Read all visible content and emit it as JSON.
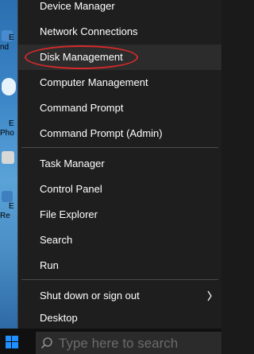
{
  "menu": {
    "items": [
      {
        "label": "Device Manager"
      },
      {
        "label": "Network Connections"
      },
      {
        "label": "Disk Management"
      },
      {
        "label": "Computer Management"
      },
      {
        "label": "Command Prompt"
      },
      {
        "label": "Command Prompt (Admin)"
      },
      {
        "label": "Task Manager"
      },
      {
        "label": "Control Panel"
      },
      {
        "label": "File Explorer"
      },
      {
        "label": "Search"
      },
      {
        "label": "Run"
      },
      {
        "label": "Shut down or sign out"
      },
      {
        "label": "Desktop"
      }
    ]
  },
  "desktop": {
    "labels": [
      "E",
      "nd",
      "E",
      "Pho",
      "E",
      "Re"
    ]
  },
  "taskbar": {
    "search_placeholder": "Type here to search"
  },
  "colors": {
    "menu_bg": "#1e1e1e",
    "highlight": "#2c2c2c",
    "annotation": "#d42a2a",
    "windows_blue": "#1e90ff"
  },
  "icons": [
    "windows-logo-icon",
    "search-icon",
    "chevron-right-icon"
  ]
}
